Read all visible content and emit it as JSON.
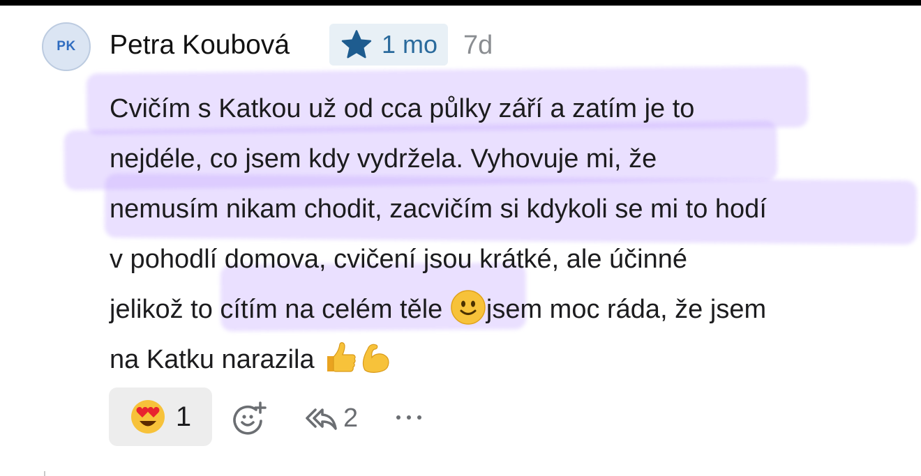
{
  "comment": {
    "avatar_initials": "PK",
    "author": "Petra Koubová",
    "badge": {
      "icon": "star-icon",
      "label": "1 mo",
      "color": "#1e5c8f"
    },
    "timestamp": "7d",
    "lines": [
      "Cvičím s Katkou už od cca půlky září a zatím je to",
      "nejdéle, co jsem kdy vydržela. Vyhovuje mi, že",
      "nemusím nikam chodit, zacvičím si kdykoli se mi to hodí",
      "v pohodlí domova, cvičení jsou krátké, ale účinné",
      "jelikož to cítím na celém těle",
      "jsem moc ráda, že jsem",
      "na Katku narazila"
    ],
    "inline_emojis": [
      "slightly-smiling-face",
      "thumbs-up",
      "flexed-biceps"
    ]
  },
  "actions": {
    "reaction": {
      "emoji": "heart-eyes-face",
      "count": "1"
    },
    "add_reaction_icon": "add-reaction-icon",
    "reply": {
      "icon": "reply-all-icon",
      "count": "2"
    },
    "more_icon": "more-horizontal-icon"
  },
  "highlight_color": "#c4aaff"
}
